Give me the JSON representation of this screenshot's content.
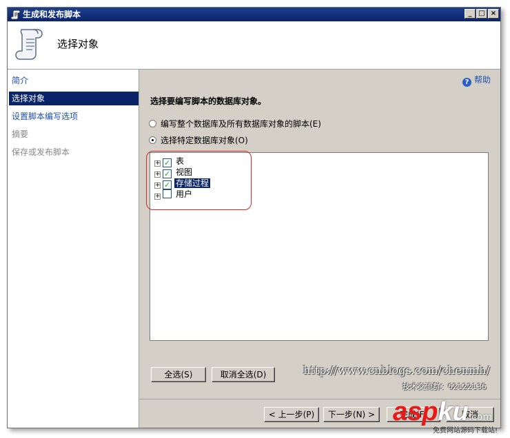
{
  "window": {
    "title": "生成和发布脚本",
    "controls": {
      "minimize": "_",
      "maximize": "□",
      "close": "×"
    }
  },
  "header": {
    "title": "选择对象",
    "icon": "script-scroll-icon"
  },
  "nav": {
    "items": [
      {
        "label": "简介",
        "state": "link"
      },
      {
        "label": "选择对象",
        "state": "selected"
      },
      {
        "label": "设置脚本编写选项",
        "state": "link"
      },
      {
        "label": "摘要",
        "state": "disabled"
      },
      {
        "label": "保存或发布脚本",
        "state": "disabled"
      }
    ]
  },
  "content": {
    "help": "帮助",
    "section_title": "选择要编写脚本的数据库对象。",
    "radio_all": "编写整个数据库及所有数据库对象的脚本(E)",
    "radio_specific": "选择特定数据库对象(O)",
    "tree": [
      {
        "label": "表",
        "checked": true,
        "selected": false
      },
      {
        "label": "视图",
        "checked": true,
        "selected": false
      },
      {
        "label": "存储过程",
        "checked": true,
        "selected": true
      },
      {
        "label": "用户",
        "checked": false,
        "selected": false
      }
    ],
    "select_all": "全选(S)",
    "deselect_all": "取消全选(D)"
  },
  "watermark": {
    "url": "http://www.cnblogs.com/chenmh/",
    "qq": "技术交流群：62122135"
  },
  "footer": {
    "prev": "< 上一步(P)",
    "next": "下一步(N) >",
    "finish": "完成(F)",
    "cancel": "取消"
  },
  "aspku": {
    "brand_red": "asp",
    "brand_blue": "ku",
    "tld": ".com",
    "tagline": "免费网站源码下载站!"
  },
  "colors": {
    "titlebar": "#0a246a",
    "selection": "#0a246a",
    "link": "#1f4fb0",
    "annotation": "#cc2b2b"
  }
}
